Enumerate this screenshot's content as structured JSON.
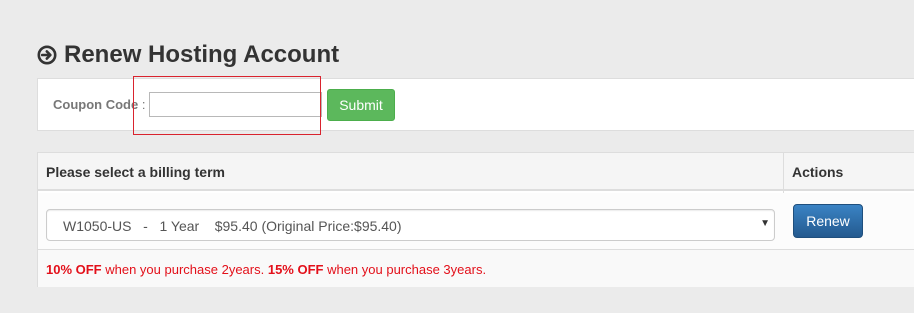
{
  "page": {
    "title": "Renew Hosting Account",
    "title_icon": "circle-arrow-right-icon"
  },
  "coupon": {
    "label": "Coupon Code",
    "colon": " :",
    "input_value": "",
    "submit_label": "Submit"
  },
  "table": {
    "headers": {
      "billing": "Please select a billing term",
      "actions": "Actions"
    },
    "selected_term": "W1050-US   -   1 Year    $95.40 (Original Price:$95.40)",
    "renew_label": "Renew",
    "discount": {
      "pct1": "10% OFF",
      "text1": " when you purchase 2years. ",
      "pct2": "15% OFF",
      "text2": " when you purchase 3years."
    }
  },
  "colors": {
    "submit": "#5cb85c",
    "renew": "#337ab7",
    "discount_text": "#e3101a",
    "highlight_box": "#d9232e"
  }
}
